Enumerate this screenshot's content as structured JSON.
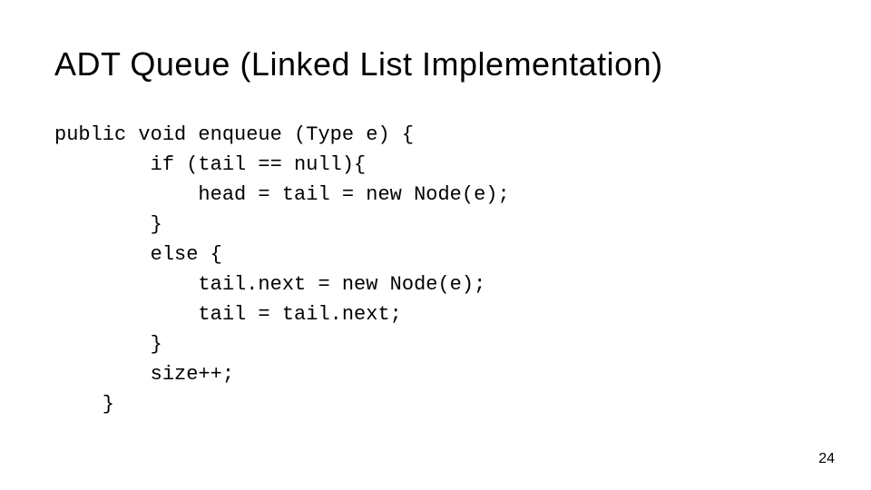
{
  "title": "ADT Queue (Linked List Implementation)",
  "code": "public void enqueue (Type e) {\n        if (tail == null){\n            head = tail = new Node(e);\n        }\n        else {\n            tail.next = new Node(e);\n            tail = tail.next;\n        }\n        size++;\n    }",
  "page_number": "24"
}
